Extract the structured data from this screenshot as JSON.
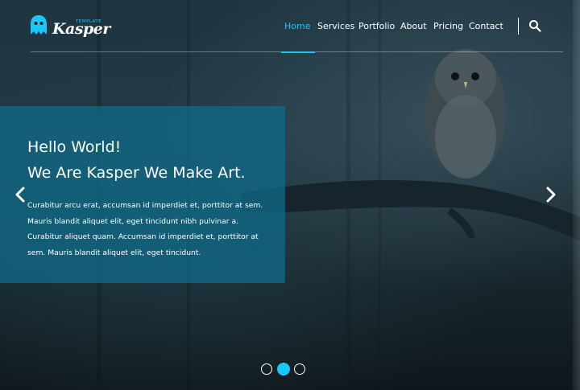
{
  "brand": {
    "small_label": "Template",
    "name": "Kasper",
    "accent": "#19c8fa"
  },
  "nav": {
    "items": [
      "Home",
      "Services",
      "Portfolio",
      "About",
      "Pricing",
      "Contact"
    ],
    "active": "Home"
  },
  "icons": {
    "search": "search-icon",
    "prev": "chevron-left-icon",
    "next": "chevron-right-icon",
    "logo": "ghost-logo-icon"
  },
  "slide": {
    "title_line1": "Hello World!",
    "title_line2": "We Are Kasper We Make Art.",
    "description": "Curabitur arcu erat, accumsan id imperdiet et, porttitor at sem. Mauris blandit aliquet elit, eget tincidunt nibh pulvinar a. Curabitur aliquet quam. Accumsan id imperdiet et, porttitor at sem. Mauris blandit aliquet elit, eget tincidunt.",
    "box_color": "#0e6e8c"
  },
  "slider": {
    "count": 3,
    "active_index": 1
  }
}
